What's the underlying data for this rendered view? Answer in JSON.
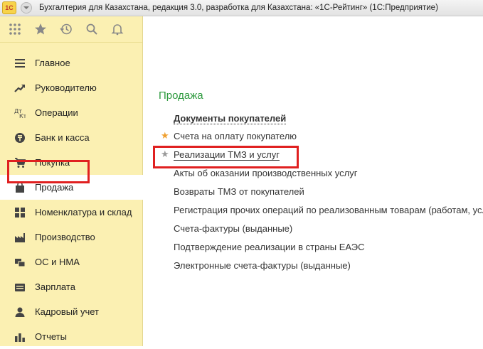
{
  "window": {
    "logo": "1С",
    "title": "Бухгалтерия для Казахстана, редакция 3.0, разработка для Казахстана: «1С-Рейтинг»  (1С:Предприятие)"
  },
  "quickbar": {
    "icons": [
      "apps-grid-icon",
      "star-icon",
      "history-icon",
      "search-icon",
      "bell-icon"
    ]
  },
  "sidebar": {
    "items": [
      {
        "label": "Главное",
        "icon": "list-icon"
      },
      {
        "label": "Руководителю",
        "icon": "trend-icon"
      },
      {
        "label": "Операции",
        "icon": "dt-kt-icon"
      },
      {
        "label": "Банк и касса",
        "icon": "tenge-coin-icon"
      },
      {
        "label": "Покупка",
        "icon": "cart-icon"
      },
      {
        "label": "Продажа",
        "icon": "bag-icon",
        "active": true
      },
      {
        "label": "Номенклатура и склад",
        "icon": "grid-icon"
      },
      {
        "label": "Производство",
        "icon": "factory-icon"
      },
      {
        "label": "ОС и НМА",
        "icon": "assets-icon"
      },
      {
        "label": "Зарплата",
        "icon": "wallet-icon"
      },
      {
        "label": "Кадровый учет",
        "icon": "person-icon"
      },
      {
        "label": "Отчеты",
        "icon": "bar-chart-icon"
      }
    ]
  },
  "main": {
    "section_title": "Продажа",
    "links": [
      {
        "label": "Документы покупателей",
        "style": "bold",
        "star": null
      },
      {
        "label": "Счета на оплату покупателю",
        "style": "normal",
        "star": "favorite"
      },
      {
        "label": "Реализации ТМЗ и услуг",
        "style": "underline",
        "star": "plain"
      },
      {
        "label": "Акты об оказании производственных услуг",
        "style": "normal",
        "star": null
      },
      {
        "label": "Возвраты ТМЗ от покупателей",
        "style": "normal",
        "star": null
      },
      {
        "label": "Регистрация прочих операций по реализованным товарам (работам, усл",
        "style": "normal",
        "star": null
      },
      {
        "label": "Счета-фактуры (выданные)",
        "style": "normal",
        "star": null
      },
      {
        "label": "Подтверждение реализации в страны ЕАЭС",
        "style": "normal",
        "star": null
      },
      {
        "label": "Электронные счета-фактуры (выданные)",
        "style": "normal",
        "star": null
      }
    ]
  },
  "colors": {
    "sidebar_bg": "#fbf0b2",
    "section_title": "#2d9a3e",
    "highlight_box": "#e02020",
    "favorite_star": "#f0a030"
  }
}
